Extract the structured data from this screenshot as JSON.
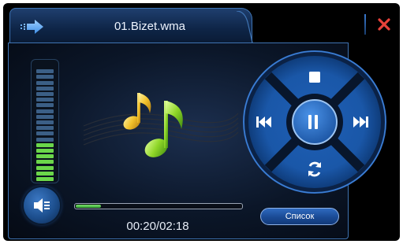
{
  "header": {
    "track_title": "01.Bizet.wma",
    "back_icon": "arrow-right-icon",
    "close_icon": "close-x-icon"
  },
  "volume": {
    "total_segments": 20,
    "active_segments": 7,
    "icon": "speaker-icon"
  },
  "album_art": {
    "icon": "music-notes-icon"
  },
  "playback": {
    "progress_fraction": 0.15,
    "time_text": "00:20/02:18"
  },
  "controls": {
    "stop_icon": "stop-icon",
    "prev_icon": "previous-icon",
    "pause_icon": "pause-icon",
    "next_icon": "next-icon",
    "repeat_icon": "repeat-icon"
  },
  "list_button_label": "Список",
  "colors": {
    "accent_blue": "#2b6cc4",
    "close_red": "#e8423a",
    "meter_green": "#6bd64a",
    "meter_off": "#3b5f86"
  }
}
